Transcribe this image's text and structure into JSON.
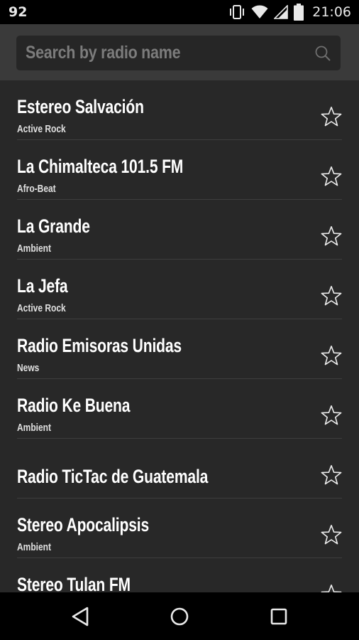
{
  "status_bar": {
    "notification_count": "92",
    "time": "21:06",
    "icons": [
      "vibrate-icon",
      "wifi-icon",
      "cell-signal-icon",
      "battery-icon"
    ]
  },
  "search": {
    "placeholder": "Search by radio name",
    "value": "",
    "icon": "search-icon"
  },
  "stations": [
    {
      "name": "Estereo Salvación",
      "genre": "Active Rock"
    },
    {
      "name": "La Chimalteca 101.5 FM",
      "genre": "Afro-Beat"
    },
    {
      "name": "La Grande",
      "genre": "Ambient"
    },
    {
      "name": "La Jefa",
      "genre": "Active Rock"
    },
    {
      "name": "Radio Emisoras Unidas",
      "genre": "News"
    },
    {
      "name": "Radio Ke Buena",
      "genre": "Ambient"
    },
    {
      "name": "Radio TicTac de Guatemala",
      "genre": ""
    },
    {
      "name": "Stereo Apocalipsis",
      "genre": "Ambient"
    },
    {
      "name": "Stereo Tulan FM",
      "genre": ""
    }
  ],
  "nav_bar": {
    "buttons": [
      "back-icon",
      "home-icon",
      "recents-icon"
    ]
  },
  "colors": {
    "background": "#282828",
    "header": "#3a3a3a",
    "search_box": "#262626",
    "text": "#ffffff",
    "divider": "#3e3e3e"
  }
}
